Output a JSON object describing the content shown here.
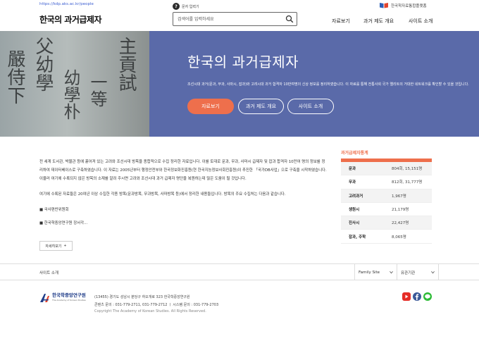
{
  "header": {
    "url": "https://kdp.aks.ac.kr/people",
    "title": "한국의 과거급제자",
    "hint_icon": "?",
    "hint": "문자 입력기",
    "search_placeholder": "검색어를 입력하세요",
    "portal": "한국학자료통합플랫폼",
    "nav": [
      "자료보기",
      "과거 제도 개요",
      "사이트 소개"
    ]
  },
  "hero": {
    "title": "한국의 과거급제자",
    "description": "조선시대 과거(문과, 무과, 사마시, 잡과)와 고려시대 과거 합격자 10만여명의 신상 정보를 정리하였습니다. 이 자료를 통해 전통사회 국가 엘리트의 거대한 네트워크를 확인할 수 있을 것입니다.",
    "buttons": [
      "자료보기",
      "과거 제도 개요",
      "사이트 소개"
    ],
    "image_glyphs": [
      "主貢試",
      "一等",
      "嚴侍下",
      "父幼學",
      "幼學朴"
    ]
  },
  "main": {
    "paragraph1": "전 세계 도서관, 박물관 등에 흩어져 있는 고려와 조선시대 방목을 종합적으로 수집 정리한 자료입니다. 이를 토대로 문과, 무과, 사마시 급제자 및 잡과 합격자 10만여 명의 정보를 정리하여 데이터베이스로 구축하였습니다. 이 자료는 2005년부터 행정안전부와 한국정보화진흥원(현 한국지능정보사회진흥원)이 추진한 「국가DB사업」으로 구축을 시작하였습니다. 이울러 여기에 수록되지 않은 방목의 소재를 알려 주시면 고려와 조선시대 과거 급제자 명단을 복원하는데 많은 도움이 될 것입니다.",
    "paragraph2": "여기에 수록된 자료들은 20여년 이상 수집한 각종 방목(문과방목, 무과방목, 사마방목 등)에서 정리한 내용들입니다. 방목의 주요 수집처는 다음과 같습니다.",
    "item1": "■ 국사편찬위원회",
    "item2": "■ 한국학중앙연구원 장서각...",
    "more_label": "자세히보기",
    "more_icon": "+"
  },
  "stats": {
    "title": "과거급제자통계",
    "rows": [
      {
        "label": "문과",
        "value": "804회, 15,151명"
      },
      {
        "label": "무과",
        "value": "812회, 31,777명"
      },
      {
        "label": "고려과거",
        "value": "1,967명"
      },
      {
        "label": "생원시",
        "value": "21,179명"
      },
      {
        "label": "진사시",
        "value": "22,427명"
      },
      {
        "label": "잡과, 주학",
        "value": "8,065명"
      }
    ]
  },
  "bottom": {
    "sitemap": "사이트 소개",
    "family_site": "Family Site",
    "related": "유관기관"
  },
  "footer": {
    "logo_name": "한국학중앙연구원",
    "logo_sub": "The Academy of Korean Studies",
    "address": "(13455) 경기도 성남시 분당구 하오개로 323 한국학중앙연구원",
    "contacts": "콘텐츠 문의 : 031-779-2711, 031-779-2712   ㅣ   시스템 문의 : 031-779-2703",
    "copyright": "Copyright The Academy of Korean Studies. All Rights Reserved."
  },
  "colors": {
    "hero_bg": "#5a6aa9",
    "accent": "#ee6f4c",
    "url_link": "#3d5fd1"
  },
  "icons": [
    "help-icon",
    "search-icon",
    "book-icon",
    "plus-icon",
    "chevron-down-icon",
    "youtube-icon",
    "facebook-icon",
    "line-icon"
  ]
}
